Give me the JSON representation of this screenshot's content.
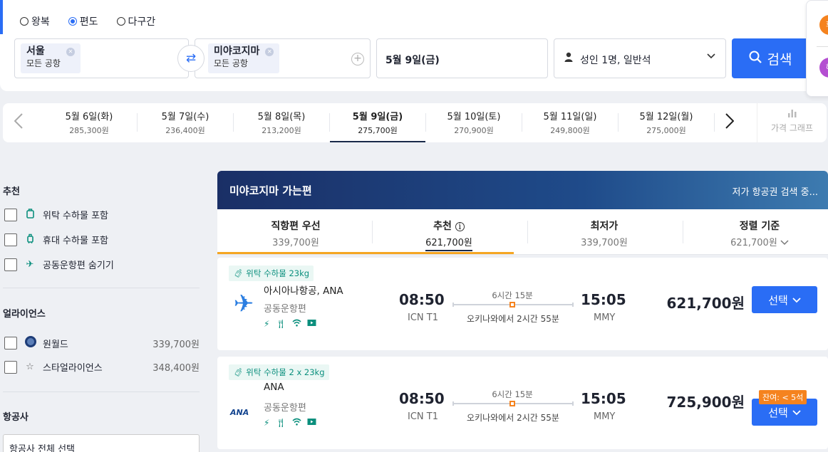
{
  "trip_types": [
    {
      "label": "왕복",
      "selected": false
    },
    {
      "label": "편도",
      "selected": true
    },
    {
      "label": "다구간",
      "selected": false
    }
  ],
  "origin": {
    "city": "서울",
    "airport": "모든 공항"
  },
  "destination": {
    "city": "미야코지마",
    "airport": "모든 공항"
  },
  "date": "5월 9일(금)",
  "passengers": "성인 1명, 일반석",
  "search_label": "검색",
  "side_avatars": [
    "회",
    "혜"
  ],
  "date_strip": [
    {
      "date": "5월 6일(화)",
      "price": "285,300원"
    },
    {
      "date": "5월 7일(수)",
      "price": "236,400원"
    },
    {
      "date": "5월 8일(목)",
      "price": "213,200원"
    },
    {
      "date": "5월 9일(금)",
      "price": "275,700원",
      "selected": true
    },
    {
      "date": "5월 10일(토)",
      "price": "270,900원"
    },
    {
      "date": "5월 11일(일)",
      "price": "249,800원"
    },
    {
      "date": "5월 12일(월)",
      "price": "275,000원"
    }
  ],
  "graph_label": "가격 그래프",
  "filters": {
    "recommend_title": "추천",
    "recommend": [
      {
        "label": "위탁 수하물 포함",
        "icon": "checked-bag-icon"
      },
      {
        "label": "휴대 수하물 포함",
        "icon": "carry-on-icon"
      },
      {
        "label": "공동운항편 숨기기",
        "icon": "plane-icon"
      }
    ],
    "alliance_title": "얼라이언스",
    "alliances": [
      {
        "label": "원월드",
        "price": "339,700원"
      },
      {
        "label": "스타얼라이언스",
        "price": "348,400원"
      }
    ],
    "airline_title": "항공사",
    "airline_all": "항공사 전체 선택"
  },
  "banner": {
    "title": "미야코지마 가는편",
    "status": "저가 항공권 검색 중..."
  },
  "sort_tabs": [
    {
      "label": "직항편 우선",
      "price": "339,700원"
    },
    {
      "label": "추천",
      "price": "621,700원",
      "selected": true
    },
    {
      "label": "최저가",
      "price": "339,700원"
    },
    {
      "label": "정렬 기준",
      "price": "621,700원"
    }
  ],
  "results": [
    {
      "bag": "위탁 수하물 23kg",
      "airline": "아시아나항공, ANA",
      "codeshare": "공동운항편",
      "dep_time": "08:50",
      "dep_airport": "ICN T1",
      "duration": "6시간 15분",
      "layover": "오키나와에서 2시간 55분",
      "arr_time": "15:05",
      "arr_airport": "MMY",
      "price": "621,700원",
      "select": "선택"
    },
    {
      "bag": "위탁 수하물 2 x 23kg",
      "airline": "ANA",
      "logo_text": "ANA",
      "codeshare": "공동운항편",
      "dep_time": "08:50",
      "dep_airport": "ICN T1",
      "duration": "6시간 15분",
      "layover": "오키나와에서 2시간 55분",
      "arr_time": "15:05",
      "arr_airport": "MMY",
      "price": "725,900원",
      "select": "선택",
      "seats_left": "잔여: < 5석"
    }
  ]
}
